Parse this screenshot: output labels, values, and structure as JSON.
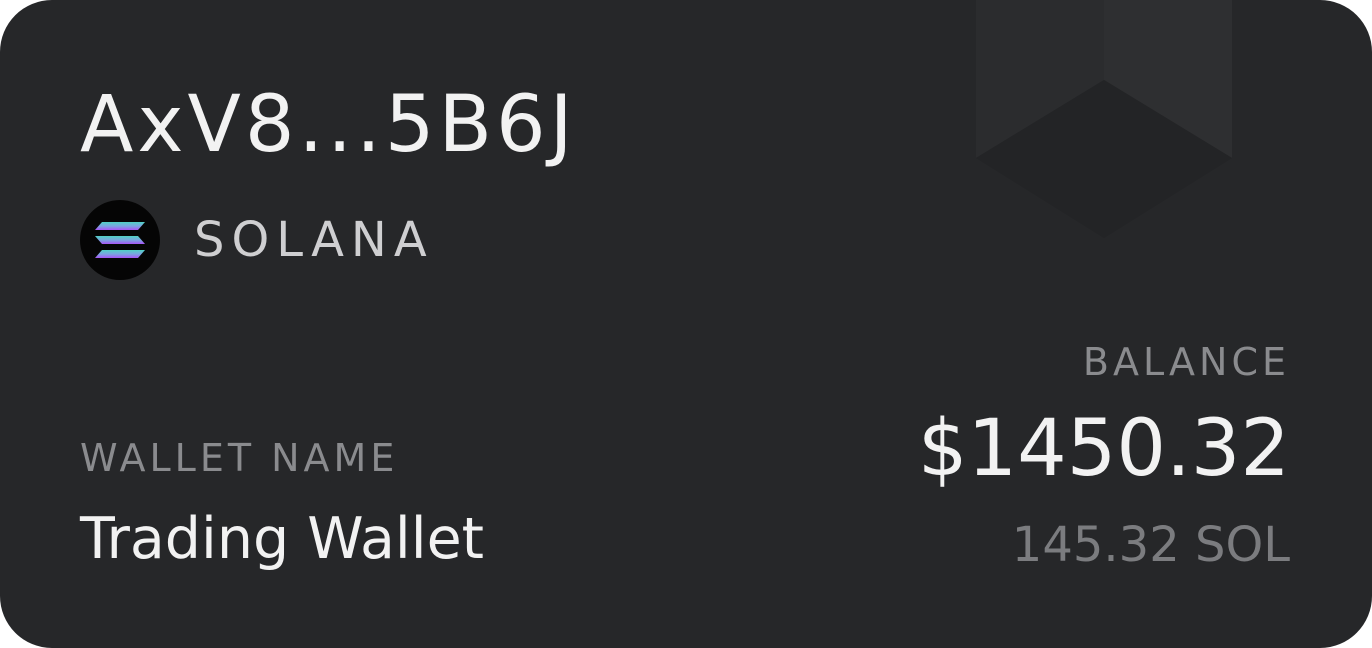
{
  "wallet": {
    "address": "AxV8...5B6J",
    "chain": "SOLANA",
    "chain_icon": "solana-logo-icon",
    "name_label": "WALLET NAME",
    "name": "Trading Wallet"
  },
  "balance": {
    "label": "BALANCE",
    "usd": "$1450.32",
    "native": "145.32 SOL"
  },
  "colors": {
    "card_background": "#262729",
    "primary_text": "#f2f2f2",
    "muted_text": "#8a8b8e",
    "solana_gradient_start": "#4fd1c5",
    "solana_gradient_end": "#a855f7"
  }
}
